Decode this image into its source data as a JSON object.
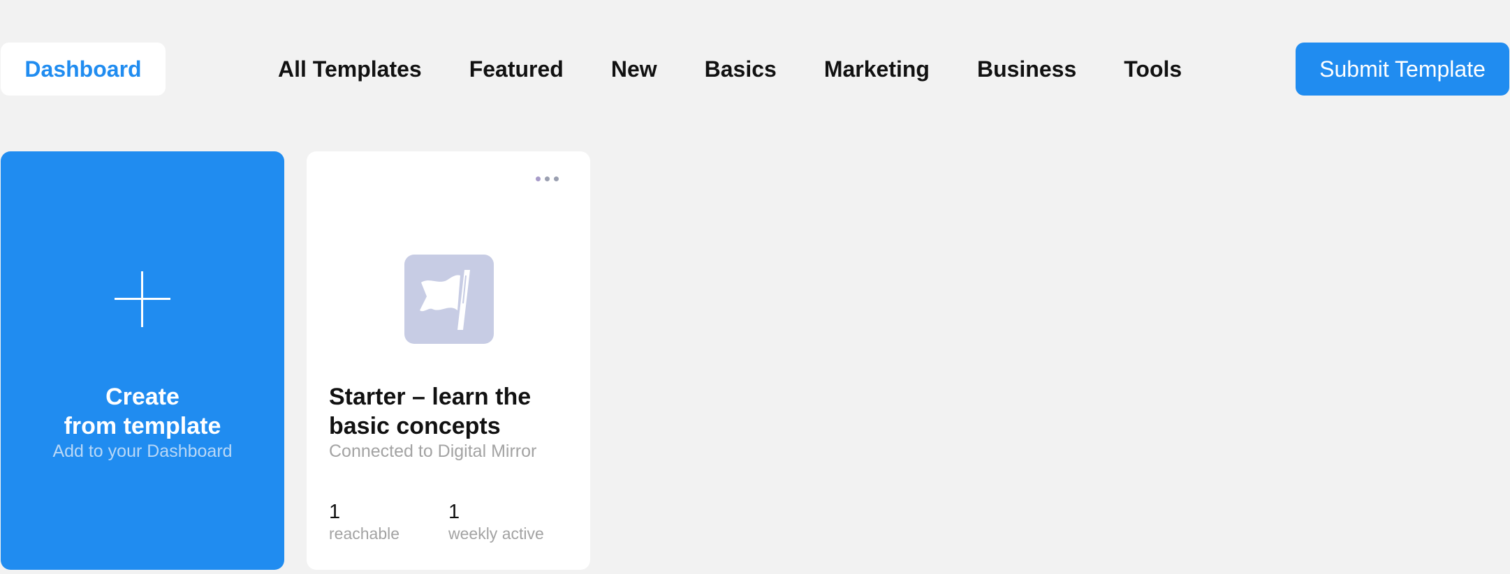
{
  "header": {
    "dashboard_label": "Dashboard",
    "nav": [
      "All Templates",
      "Featured",
      "New",
      "Basics",
      "Marketing",
      "Business",
      "Tools"
    ],
    "submit_label": "Submit Template"
  },
  "create_card": {
    "title_line1": "Create",
    "title_line2": "from template",
    "subtitle": "Add to your Dashboard",
    "icon": "plus-icon"
  },
  "template_card": {
    "title_line1": "Starter – learn the",
    "title_line2": "basic concepts",
    "subtitle": "Connected to Digital Mirror",
    "icon": "flag-icon",
    "menu_icon": "more-dots-icon",
    "stats": [
      {
        "value": "1",
        "label": "reachable"
      },
      {
        "value": "1",
        "label": "weekly active"
      }
    ]
  },
  "colors": {
    "accent": "#208cf0",
    "background": "#f2f2f2",
    "icon_tile": "#c7cce4"
  }
}
